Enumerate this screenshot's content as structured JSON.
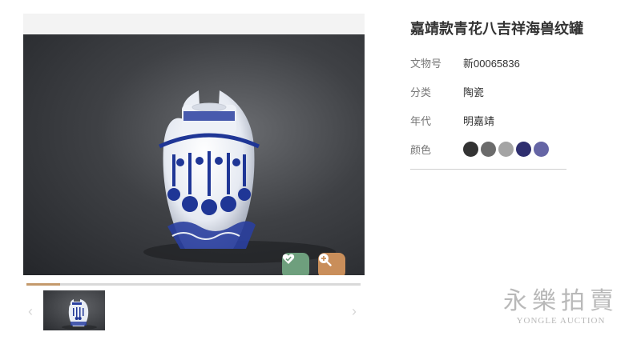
{
  "viewer": {
    "favorite_icon": "heart-icon",
    "zoom_icon": "zoom-in-icon",
    "progress_fraction": 0.1,
    "prev_icon": "chevron-left-icon",
    "prev_glyph": "‹",
    "next_icon": "chevron-right-icon",
    "next_glyph": "›"
  },
  "item": {
    "title": "嘉靖款青花八吉祥海兽纹罐",
    "fields": [
      {
        "label": "文物号",
        "value": "新00065836"
      },
      {
        "label": "分类",
        "value": "陶瓷"
      },
      {
        "label": "年代",
        "value": "明嘉靖"
      }
    ],
    "color_label": "颜色",
    "colors": [
      "#333333",
      "#6b6b6b",
      "#a4a4a4",
      "#2f2f6f",
      "#6565a5"
    ]
  },
  "watermark": {
    "chinese": "永樂拍賣",
    "english": "YONGLE AUCTION"
  }
}
